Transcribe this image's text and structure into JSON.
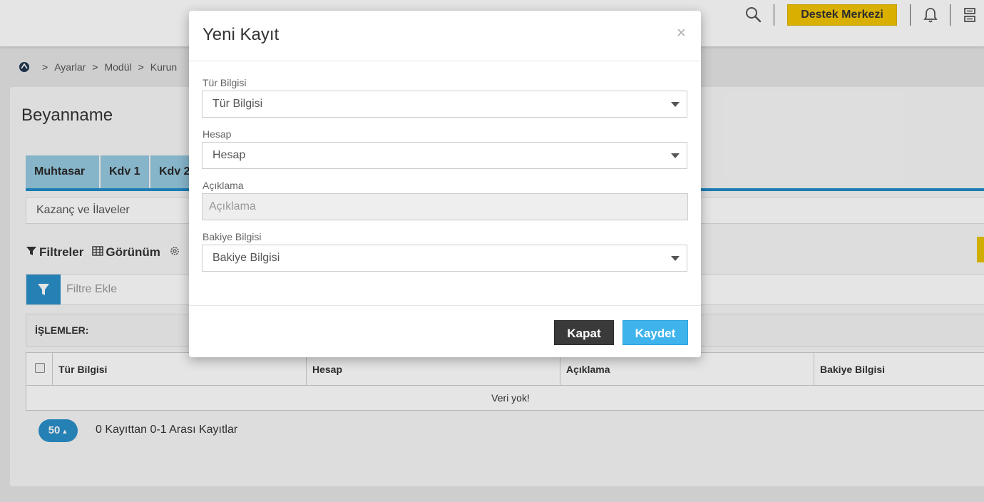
{
  "header": {
    "support_label": "Destek Merkezi"
  },
  "breadcrumb": {
    "items": [
      "Ayarlar",
      "Modül",
      "Kurun"
    ]
  },
  "page": {
    "title": "Beyanname",
    "tabs": [
      "Muhtasar",
      "Kdv 1",
      "Kdv 2"
    ],
    "sub_select_value": "Kazanç ve İlaveler",
    "toolbar": {
      "filters_label": "Filtreler",
      "view_label": "Görünüm"
    },
    "filter_placeholder": "Filtre Ekle",
    "operations_label": "İŞLEMLER:",
    "grid": {
      "columns": [
        "Tür Bilgisi",
        "Hesap",
        "Açıklama",
        "Bakiye Bilgisi"
      ],
      "empty_text": "Veri yok!"
    },
    "pager": {
      "page_size": "50",
      "info": "0 Kayıttan 0-1 Arası Kayıtlar"
    }
  },
  "modal": {
    "title": "Yeni Kayıt",
    "close_symbol": "×",
    "fields": {
      "type": {
        "label": "Tür Bilgisi",
        "value": "Tür Bilgisi"
      },
      "account": {
        "label": "Hesap",
        "value": "Hesap"
      },
      "description": {
        "label": "Açıklama",
        "placeholder": "Açıklama"
      },
      "balance": {
        "label": "Bakiye Bilgisi",
        "value": "Bakiye Bilgisi"
      }
    },
    "buttons": {
      "close": "Kapat",
      "save": "Kaydet"
    }
  },
  "colors": {
    "accent": "#2a8fc9",
    "support_yellow": "#f2c500",
    "tab_bg": "#96c9e0",
    "save_button": "#3fb4ec",
    "close_button": "#3a3a3a"
  },
  "icons": {
    "search": "search-icon",
    "bell": "bell-icon",
    "apps": "apps-icon",
    "home": "home-icon",
    "filter": "filter-icon",
    "grid": "grid-icon",
    "settings": "gear-icon"
  }
}
